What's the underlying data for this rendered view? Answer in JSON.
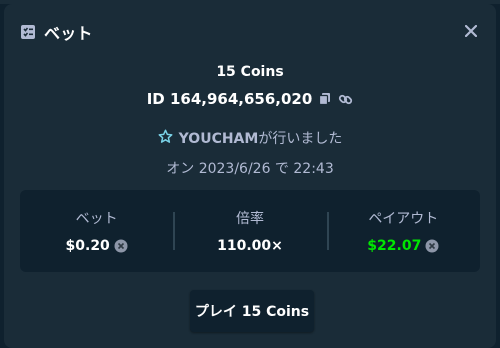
{
  "modal": {
    "title": "ベット",
    "close_icon": "close-icon"
  },
  "bet": {
    "amount_label": "15 Coins",
    "id_label": "ID 164,964,656,020",
    "player_name": "YOUCHAM",
    "player_suffix": "が行いました",
    "date_text": "オン 2023/6/26 で 22:43"
  },
  "stats": {
    "bet_label": "ベット",
    "bet_value": "$0.20",
    "multiplier_label": "倍率",
    "multiplier_value": "110.00×",
    "payout_label": "ペイアウト",
    "payout_value": "$22.07"
  },
  "play_button": {
    "label": "プレイ 15 Coins"
  },
  "colors": {
    "background": "#0f212e",
    "panel": "#1a2c38",
    "muted_text": "#b1bad3",
    "payout_green": "#00e701"
  }
}
